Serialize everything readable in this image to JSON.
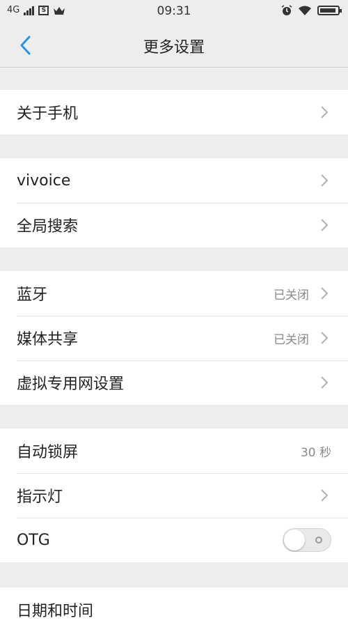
{
  "status_bar": {
    "network": "4G",
    "time": "09:31",
    "icons": [
      "signal-icon",
      "sim-s-icon",
      "crown-icon",
      "alarm-icon",
      "wifi-icon",
      "battery-icon"
    ]
  },
  "header": {
    "title": "更多设置",
    "back_icon": "chevron-left-icon"
  },
  "groups": [
    {
      "rows": [
        {
          "label": "关于手机"
        }
      ]
    },
    {
      "rows": [
        {
          "label": "vivoice"
        },
        {
          "label": "全局搜索"
        }
      ]
    },
    {
      "rows": [
        {
          "label": "蓝牙",
          "value": "已关闭"
        },
        {
          "label": "媒体共享",
          "value": "已关闭"
        },
        {
          "label": "虚拟专用网设置"
        }
      ]
    },
    {
      "rows": [
        {
          "label": "自动锁屏",
          "value": "30 秒"
        },
        {
          "label": "指示灯"
        },
        {
          "label": "OTG",
          "toggle": "off"
        }
      ]
    },
    {
      "rows": [
        {
          "label": "日期和时间"
        }
      ]
    }
  ],
  "colors": {
    "background": "#ededed",
    "accent": "#2196e8",
    "card": "#ffffff"
  }
}
